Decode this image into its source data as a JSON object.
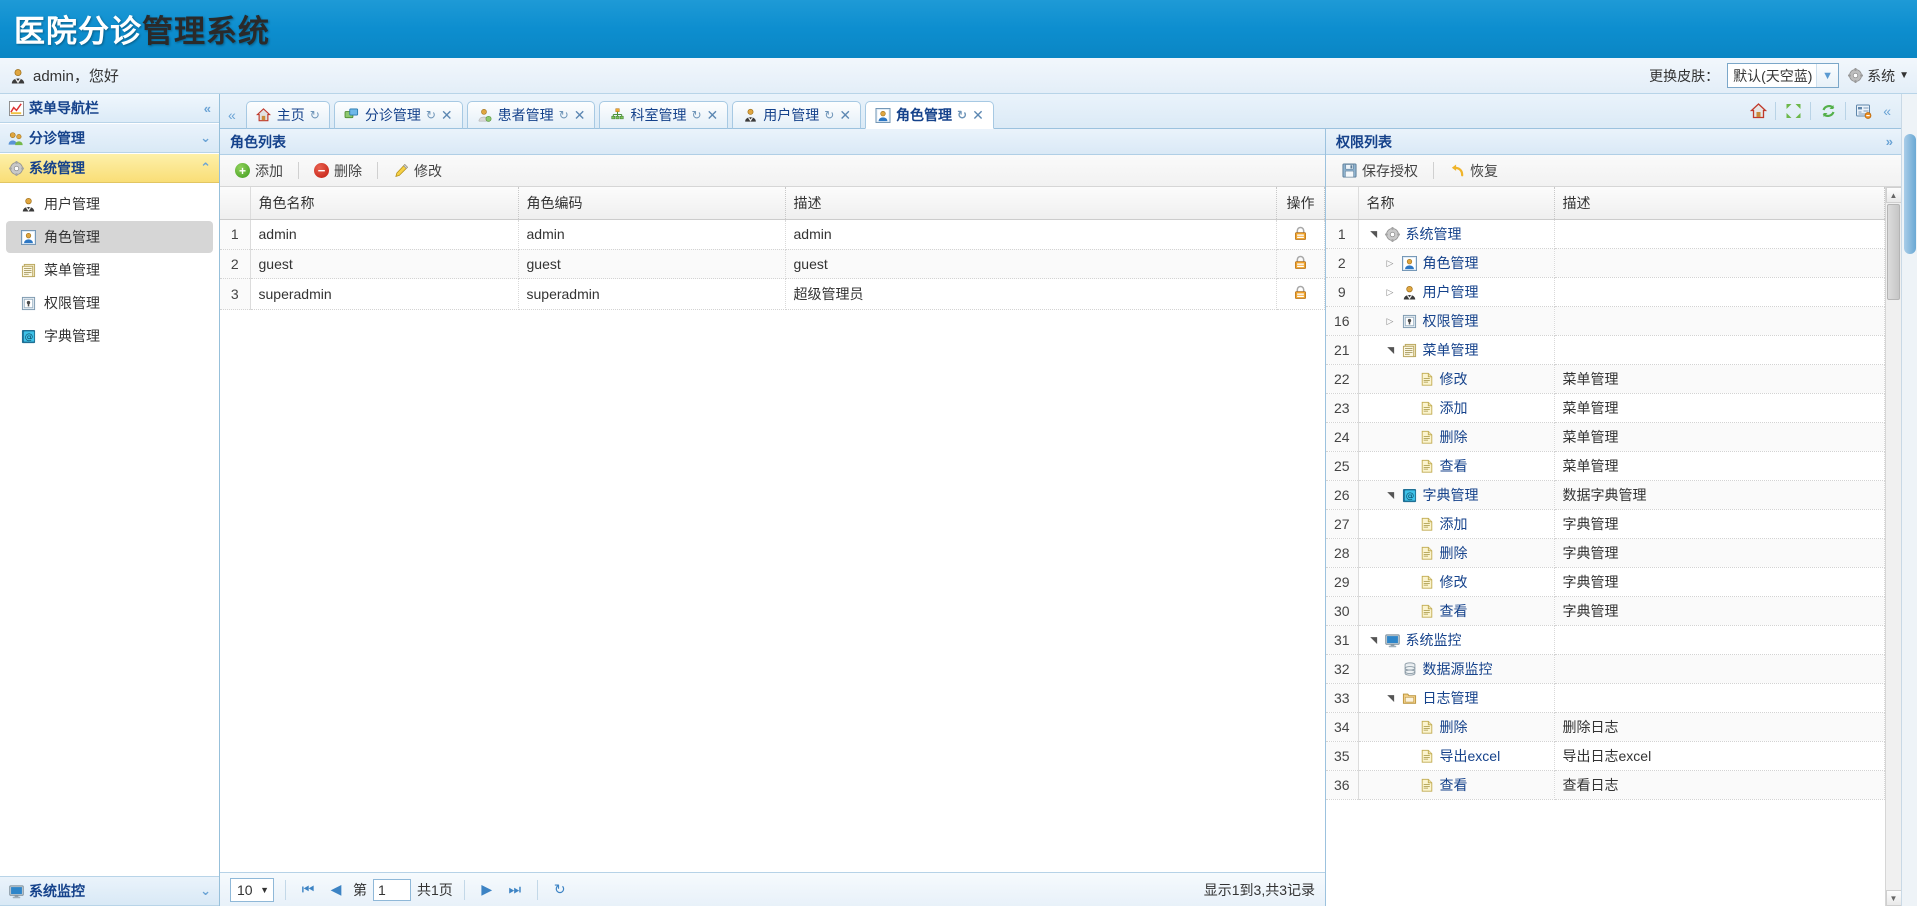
{
  "header": {
    "title_part1": "医院分诊",
    "title_part2": "管理系统"
  },
  "userbar": {
    "greeting": "admin，您好",
    "avatar_icon": "user-avatar-icon",
    "skin_label": "更换皮肤：",
    "skin_value": "默认(天空蓝)",
    "system_label": "系统",
    "system_icon": "gear-icon",
    "collapse_icon": "chevron-up-icon"
  },
  "sidebar": {
    "nav_title": "菜单导航栏",
    "nav_icon": "nav-chart-icon",
    "nav_collapse_icon": "double-chevron-left-icon",
    "groups": [
      {
        "label": "分诊管理",
        "icon": "triage-users-icon",
        "state_icon": "chevron-down-icon",
        "expanded": false
      },
      {
        "label": "系统管理",
        "icon": "gear-icon",
        "state_icon": "chevron-up-icon",
        "expanded": true
      }
    ],
    "items": [
      {
        "label": "用户管理",
        "icon": "user-icon",
        "selected": false
      },
      {
        "label": "角色管理",
        "icon": "role-icon",
        "selected": true
      },
      {
        "label": "菜单管理",
        "icon": "menu-doc-icon",
        "selected": false
      },
      {
        "label": "权限管理",
        "icon": "permission-lock-icon",
        "selected": false
      },
      {
        "label": "字典管理",
        "icon": "dictionary-icon",
        "selected": false
      }
    ],
    "bottom_group": {
      "label": "系统监控",
      "icon": "monitor-icon",
      "state_icon": "chevron-down-icon"
    }
  },
  "tabs": {
    "collapse_icon": "double-chevron-left-icon",
    "items": [
      {
        "label": "主页",
        "icon": "home-icon",
        "active": false,
        "closable": false,
        "refresh_icon": "refresh-icon"
      },
      {
        "label": "分诊管理",
        "icon": "triage-icon",
        "active": false,
        "closable": true,
        "refresh_icon": "refresh-icon",
        "close_icon": "close-icon"
      },
      {
        "label": "患者管理",
        "icon": "patient-icon",
        "active": false,
        "closable": true,
        "refresh_icon": "refresh-icon",
        "close_icon": "close-icon"
      },
      {
        "label": "科室管理",
        "icon": "department-icon",
        "active": false,
        "closable": true,
        "refresh_icon": "refresh-icon",
        "close_icon": "close-icon"
      },
      {
        "label": "用户管理",
        "icon": "user-icon",
        "active": false,
        "closable": true,
        "refresh_icon": "refresh-icon",
        "close_icon": "close-icon"
      },
      {
        "label": "角色管理",
        "icon": "role-icon",
        "active": true,
        "closable": true,
        "refresh_icon": "refresh-icon",
        "close_icon": "close-icon"
      }
    ],
    "tools": [
      {
        "name": "home-tool-icon",
        "glyph": "⌂"
      },
      {
        "name": "fullscreen-tool-icon",
        "glyph": "⤢"
      },
      {
        "name": "refresh-tool-icon",
        "glyph": "⟳"
      },
      {
        "name": "close-others-tool-icon",
        "glyph": "▤"
      }
    ],
    "panel_collapse_icon": "double-chevron-left-icon"
  },
  "role_panel": {
    "title": "角色列表",
    "toolbar": [
      {
        "label": "添加",
        "icon": "add-icon"
      },
      {
        "label": "删除",
        "icon": "delete-icon"
      },
      {
        "label": "修改",
        "icon": "edit-icon"
      }
    ],
    "columns": [
      "",
      "角色名称",
      "角色编码",
      "描述",
      "操作"
    ],
    "rows": [
      {
        "index": "1",
        "name": "admin",
        "code": "admin",
        "desc": "admin",
        "op_icon": "lock-icon"
      },
      {
        "index": "2",
        "name": "guest",
        "code": "guest",
        "desc": "guest",
        "op_icon": "lock-icon"
      },
      {
        "index": "3",
        "name": "superadmin",
        "code": "superadmin",
        "desc": "超级管理员",
        "op_icon": "lock-icon"
      }
    ],
    "pager": {
      "page_size": "10",
      "first_icon": "first-page-icon",
      "prev_icon": "prev-page-icon",
      "page_prefix": "第",
      "page_value": "1",
      "page_suffix": "共1页",
      "next_icon": "next-page-icon",
      "last_icon": "last-page-icon",
      "reload_icon": "reload-icon",
      "info": "显示1到3,共3记录"
    }
  },
  "perm_panel": {
    "title": "权限列表",
    "collapse_icon": "double-chevron-right-icon",
    "toolbar": [
      {
        "label": "保存授权",
        "icon": "save-icon"
      },
      {
        "label": "恢复",
        "icon": "undo-icon"
      }
    ],
    "columns": [
      "",
      "名称",
      "描述"
    ],
    "rows": [
      {
        "index": "1",
        "depth": 0,
        "expander": "expanded",
        "icon": "gear-icon",
        "name": "系统管理",
        "desc": ""
      },
      {
        "index": "2",
        "depth": 1,
        "expander": "collapsed",
        "icon": "role-icon",
        "name": "角色管理",
        "desc": ""
      },
      {
        "index": "9",
        "depth": 1,
        "expander": "collapsed",
        "icon": "user-icon",
        "name": "用户管理",
        "desc": ""
      },
      {
        "index": "16",
        "depth": 1,
        "expander": "collapsed",
        "icon": "permission-lock-icon",
        "name": "权限管理",
        "desc": ""
      },
      {
        "index": "21",
        "depth": 1,
        "expander": "expanded",
        "icon": "menu-doc-icon",
        "name": "菜单管理",
        "desc": ""
      },
      {
        "index": "22",
        "depth": 2,
        "expander": "none",
        "icon": "doc-icon",
        "name": "修改",
        "desc": "菜单管理"
      },
      {
        "index": "23",
        "depth": 2,
        "expander": "none",
        "icon": "doc-icon",
        "name": "添加",
        "desc": "菜单管理"
      },
      {
        "index": "24",
        "depth": 2,
        "expander": "none",
        "icon": "doc-icon",
        "name": "删除",
        "desc": "菜单管理"
      },
      {
        "index": "25",
        "depth": 2,
        "expander": "none",
        "icon": "doc-icon",
        "name": "查看",
        "desc": "菜单管理"
      },
      {
        "index": "26",
        "depth": 1,
        "expander": "expanded",
        "icon": "dictionary-icon",
        "name": "字典管理",
        "desc": "数据字典管理"
      },
      {
        "index": "27",
        "depth": 2,
        "expander": "none",
        "icon": "doc-icon",
        "name": "添加",
        "desc": "字典管理"
      },
      {
        "index": "28",
        "depth": 2,
        "expander": "none",
        "icon": "doc-icon",
        "name": "删除",
        "desc": "字典管理"
      },
      {
        "index": "29",
        "depth": 2,
        "expander": "none",
        "icon": "doc-icon",
        "name": "修改",
        "desc": "字典管理"
      },
      {
        "index": "30",
        "depth": 2,
        "expander": "none",
        "icon": "doc-icon",
        "name": "查看",
        "desc": "字典管理"
      },
      {
        "index": "31",
        "depth": 0,
        "expander": "expanded",
        "icon": "monitor-icon",
        "name": "系统监控",
        "desc": ""
      },
      {
        "index": "32",
        "depth": 1,
        "expander": "none",
        "icon": "database-icon",
        "name": "数据源监控",
        "desc": ""
      },
      {
        "index": "33",
        "depth": 1,
        "expander": "expanded",
        "icon": "folder-icon",
        "name": "日志管理",
        "desc": ""
      },
      {
        "index": "34",
        "depth": 2,
        "expander": "none",
        "icon": "doc-icon",
        "name": "删除",
        "desc": "删除日志"
      },
      {
        "index": "35",
        "depth": 2,
        "expander": "none",
        "icon": "doc-icon",
        "name": "导出excel",
        "desc": "导出日志excel"
      },
      {
        "index": "36",
        "depth": 2,
        "expander": "none",
        "icon": "doc-icon",
        "name": "查看",
        "desc": "查看日志"
      }
    ]
  },
  "colors": {
    "brand": "#0d8ecf",
    "accent_yellow": "#f9de77",
    "header_text": "#15428b",
    "selection_gray": "#d6d6d6"
  }
}
